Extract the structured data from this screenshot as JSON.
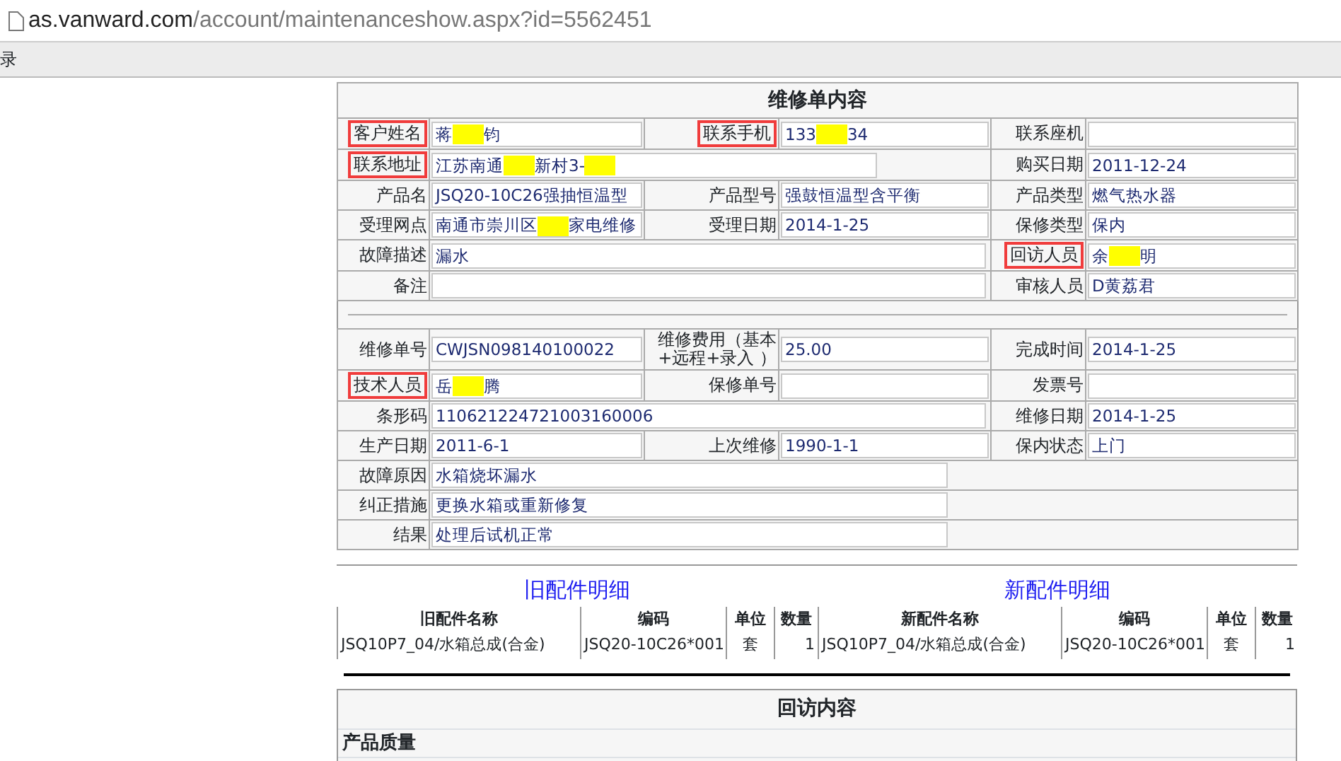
{
  "browser": {
    "url_host": "as.vanward.com",
    "url_path": "/account/maintenanceshow.aspx?id=5562451",
    "bookmark": "录"
  },
  "order": {
    "title": "维修单内容",
    "sections": [
      [
        [
          {
            "label": "客户姓名",
            "highlighted": true,
            "kind": "field",
            "value": [
              {
                "kind": "text",
                "text": "蒋"
              },
              {
                "kind": "redaction"
              },
              {
                "kind": "text",
                "text": "钧"
              }
            ]
          },
          {
            "label": "联系手机",
            "highlighted": true,
            "kind": "field",
            "value": [
              {
                "kind": "text",
                "text": "133"
              },
              {
                "kind": "redaction"
              },
              {
                "kind": "text",
                "text": "34"
              }
            ]
          },
          {
            "label": "联系座机",
            "highlighted": false,
            "kind": "field"
          }
        ],
        [
          {
            "label": "联系地址",
            "highlighted": true,
            "kind": "wide",
            "value": [
              {
                "kind": "text",
                "text": "江苏南通"
              },
              {
                "kind": "redaction"
              },
              {
                "kind": "text",
                "text": "新村3-"
              },
              {
                "kind": "redaction"
              }
            ]
          },
          {
            "label": "购买日期",
            "highlighted": false,
            "kind": "field",
            "value": [
              {
                "kind": "text",
                "text": "2011-12-24"
              }
            ]
          }
        ],
        [
          {
            "label": "产品名",
            "highlighted": false,
            "kind": "field",
            "value": [
              {
                "kind": "text",
                "text": "JSQ20-10C26强抽恒温型"
              }
            ]
          },
          {
            "label": "产品型号",
            "highlighted": false,
            "kind": "field",
            "value": [
              {
                "kind": "text",
                "text": "强鼓恒温型含平衡"
              }
            ]
          },
          {
            "label": "产品类型",
            "highlighted": false,
            "kind": "field",
            "value": [
              {
                "kind": "text",
                "text": "燃气热水器"
              }
            ]
          }
        ],
        [
          {
            "label": "受理网点",
            "highlighted": false,
            "kind": "field",
            "value": [
              {
                "kind": "text",
                "text": "南通市崇川区"
              },
              {
                "kind": "redaction"
              },
              {
                "kind": "text",
                "text": "家电维修"
              }
            ]
          },
          {
            "label": "受理日期",
            "highlighted": false,
            "kind": "field",
            "value": [
              {
                "kind": "text",
                "text": "2014-1-25"
              }
            ]
          },
          {
            "label": "保修类型",
            "highlighted": false,
            "kind": "field",
            "value": [
              {
                "kind": "text",
                "text": "保内"
              }
            ]
          }
        ],
        [
          {
            "label": "故障描述",
            "highlighted": false,
            "kind": "wide",
            "value": [
              {
                "kind": "text",
                "text": "漏水"
              }
            ]
          },
          {
            "label": "回访人员",
            "highlighted": true,
            "kind": "field",
            "value": [
              {
                "kind": "text",
                "text": "余"
              },
              {
                "kind": "redaction"
              },
              {
                "kind": "text",
                "text": "明"
              }
            ]
          }
        ],
        [
          {
            "label": "备注",
            "highlighted": false,
            "kind": "wide"
          },
          {
            "label": "审核人员",
            "highlighted": false,
            "kind": "field",
            "value": [
              {
                "kind": "text",
                "text": "D黄荔君"
              }
            ]
          }
        ]
      ],
      [
        [
          {
            "label": "维修单号",
            "highlighted": false,
            "kind": "field",
            "value": [
              {
                "kind": "text",
                "text": "CWJSN098140100022"
              }
            ]
          },
          {
            "label": "维修费用（基本+远程+录入 ）",
            "highlighted": false,
            "kind": "field",
            "value": [
              {
                "kind": "text",
                "text": "25.00"
              }
            ]
          },
          {
            "label": "完成时间",
            "highlighted": false,
            "kind": "field",
            "value": [
              {
                "kind": "text",
                "text": "2014-1-25"
              }
            ]
          }
        ],
        [
          {
            "label": "技术人员",
            "highlighted": true,
            "kind": "field",
            "value": [
              {
                "kind": "text",
                "text": "岳"
              },
              {
                "kind": "redaction"
              },
              {
                "kind": "text",
                "text": "腾"
              }
            ]
          },
          {
            "label": "保修单号",
            "highlighted": false,
            "kind": "field"
          },
          {
            "label": "发票号",
            "highlighted": false,
            "kind": "field"
          }
        ],
        [
          {
            "label": "条形码",
            "highlighted": false,
            "kind": "wide",
            "value": [
              {
                "kind": "text",
                "text": "110621224721003160006"
              }
            ]
          },
          {
            "label": "维修日期",
            "highlighted": false,
            "kind": "field",
            "value": [
              {
                "kind": "text",
                "text": "2014-1-25"
              }
            ]
          }
        ],
        [
          {
            "label": "生产日期",
            "highlighted": false,
            "kind": "field",
            "value": [
              {
                "kind": "text",
                "text": "2011-6-1"
              }
            ]
          },
          {
            "label": "上次维修",
            "highlighted": false,
            "kind": "field",
            "value": [
              {
                "kind": "text",
                "text": "1990-1-1"
              }
            ]
          },
          {
            "label": "保内状态",
            "highlighted": false,
            "kind": "field",
            "value": [
              {
                "kind": "text",
                "text": "上门"
              }
            ]
          }
        ],
        [
          {
            "label": "故障原因",
            "highlighted": false,
            "kind": "full",
            "value": [
              {
                "kind": "text",
                "text": "水箱烧坏漏水"
              }
            ]
          }
        ],
        [
          {
            "label": "纠正措施",
            "highlighted": false,
            "kind": "full",
            "value": [
              {
                "kind": "text",
                "text": "更换水箱或重新修复"
              }
            ]
          }
        ],
        [
          {
            "label": "结果",
            "highlighted": false,
            "kind": "full",
            "value": [
              {
                "kind": "text",
                "text": "处理后试机正常"
              }
            ]
          }
        ]
      ]
    ]
  },
  "parts": {
    "old_title": "旧配件明细",
    "new_title": "新配件明细",
    "columns": [
      "旧配件名称",
      "编码",
      "单位",
      "数量",
      "新配件名称",
      "编码",
      "单位",
      "数量"
    ],
    "rows": [
      [
        "JSQ10P7_04/水箱总成(合金)",
        "JSQ20-10C26*001",
        "套",
        "1",
        "JSQ10P7_04/水箱总成(合金)",
        "JSQ20-10C26*001",
        "套",
        "1"
      ]
    ]
  },
  "visit": {
    "title": "回访内容",
    "section": "产品质量"
  }
}
